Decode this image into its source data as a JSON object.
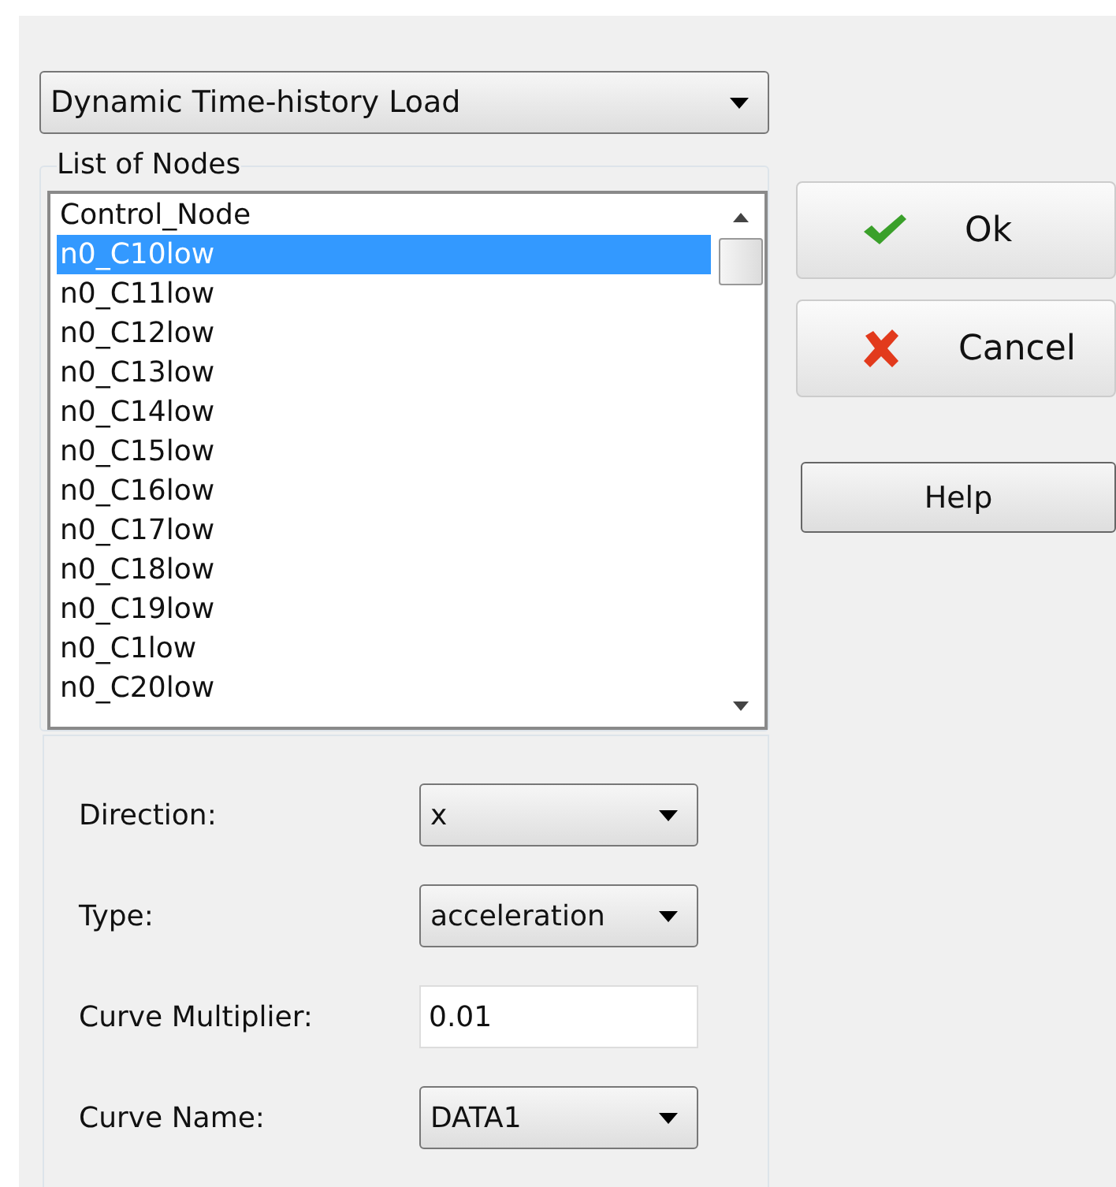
{
  "load_type": {
    "value": "Dynamic Time-history Load"
  },
  "node_list": {
    "title": "List of Nodes",
    "items": [
      {
        "label": "Control_Node",
        "selected": false
      },
      {
        "label": "n0_C10low",
        "selected": true
      },
      {
        "label": "n0_C11low",
        "selected": false
      },
      {
        "label": "n0_C12low",
        "selected": false
      },
      {
        "label": "n0_C13low",
        "selected": false
      },
      {
        "label": "n0_C14low",
        "selected": false
      },
      {
        "label": "n0_C15low",
        "selected": false
      },
      {
        "label": "n0_C16low",
        "selected": false
      },
      {
        "label": "n0_C17low",
        "selected": false
      },
      {
        "label": "n0_C18low",
        "selected": false
      },
      {
        "label": "n0_C19low",
        "selected": false
      },
      {
        "label": "n0_C1low",
        "selected": false
      },
      {
        "label": "n0_C20low",
        "selected": false
      }
    ]
  },
  "fields": [
    {
      "label": "Direction:",
      "kind": "dropdown",
      "value": "x"
    },
    {
      "label": "Type:",
      "kind": "dropdown",
      "value": "acceleration"
    },
    {
      "label": "Curve Multiplier:",
      "kind": "text",
      "value": "0.01"
    },
    {
      "label": "Curve Name:",
      "kind": "dropdown",
      "value": "DATA1"
    }
  ],
  "buttons": [
    {
      "label": "Ok",
      "kind": "ok"
    },
    {
      "label": "Cancel",
      "kind": "cancel"
    },
    {
      "label": "Help",
      "kind": "plain"
    }
  ]
}
